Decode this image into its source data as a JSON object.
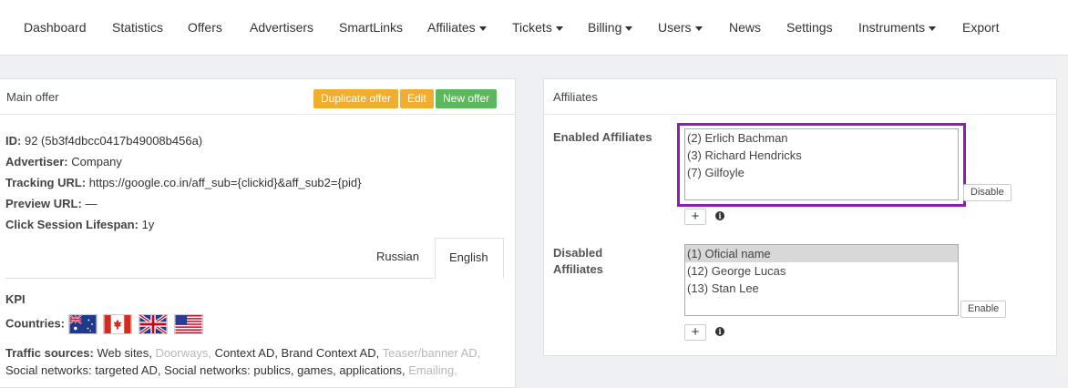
{
  "nav": {
    "dashboard": "Dashboard",
    "statistics": "Statistics",
    "offers": "Offers",
    "advertisers": "Advertisers",
    "smartlinks": "SmartLinks",
    "affiliates": "Affiliates",
    "tickets": "Tickets",
    "billing": "Billing",
    "users": "Users",
    "news": "News",
    "settings": "Settings",
    "instruments": "Instruments",
    "export": "Export"
  },
  "main_offer": {
    "title": "Main offer",
    "duplicate_label": "Duplicate offer",
    "edit_label": "Edit",
    "new_label": "New offer",
    "id_label": "ID:",
    "id_value": "92 (5b3f4dbcc0417b49008b456a)",
    "advertiser_label": "Advertiser:",
    "advertiser_value": "Company",
    "tracking_label": "Tracking URL:",
    "tracking_value": "https://google.co.in/aff_sub={clickid}&aff_sub2={pid}",
    "preview_label": "Preview URL:",
    "preview_value": "—",
    "session_label": "Click Session Lifespan:",
    "session_value": "1y",
    "tab_russian": "Russian",
    "tab_english": "English",
    "kpi_title": "KPI",
    "countries_label": "Countries:",
    "traffic_label": "Traffic sources:",
    "traffic_1": "Web sites,",
    "traffic_2": "Doorways,",
    "traffic_3": "Context AD, Brand Context AD,",
    "traffic_4": "Teaser/banner AD,",
    "traffic_5": "Social networks: targeted AD, Social networks: publics, games, applications,",
    "traffic_6": "Emailing,"
  },
  "affiliates": {
    "title": "Affiliates",
    "enabled_label": "Enabled Affiliates",
    "enabled": [
      "(2) Erlich Bachman",
      "(3) Richard Hendricks",
      "(7) Gilfoyle"
    ],
    "disable_label": "Disable",
    "disabled_label_1": "Disabled",
    "disabled_label_2": "Affiliates",
    "disabled": [
      "(1) Oficial name",
      "(12) George Lucas",
      "(13) Stan Lee"
    ],
    "enable_label": "Enable",
    "plus": "+",
    "info": "i"
  },
  "colors": {
    "accent_orange": "#f0ad2e",
    "accent_green": "#5cb85c",
    "highlight_purple": "#8b1fb0"
  }
}
